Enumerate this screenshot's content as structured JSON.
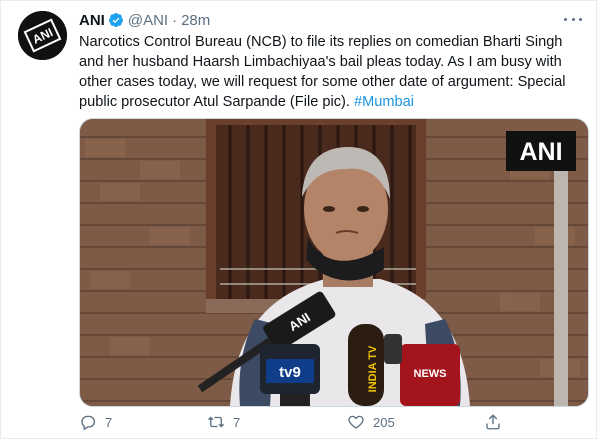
{
  "tweet": {
    "author_name": "ANI",
    "handle": "@ANI",
    "separator": "·",
    "time": "28m",
    "avatar_text": "ANI",
    "body": "Narcotics Control Bureau (NCB) to file its replies on comedian Bharti Singh\nand her husband Haarsh Limbachiyaa's bail pleas today. As I am busy with\nother cases today, we will request for some other date of argument: Special\npublic prosecutor Atul Sarpande (File pic). ",
    "hashtag": "#Mumbai",
    "media": {
      "watermark": "ANI",
      "mic_labels": [
        "ANI",
        "tv9",
        "INDIA TV",
        "NEWS"
      ]
    },
    "actions": {
      "reply_icon": "reply-icon",
      "reply_count": "7",
      "retweet_icon": "retweet-icon",
      "retweet_count": "7",
      "like_icon": "like-icon",
      "like_count": "205",
      "share_icon": "share-icon"
    },
    "colors": {
      "link": "#1b95e0",
      "secondary_text": "#5b7083",
      "verified": "#1da1f2",
      "border": "#e6ecf0"
    }
  }
}
